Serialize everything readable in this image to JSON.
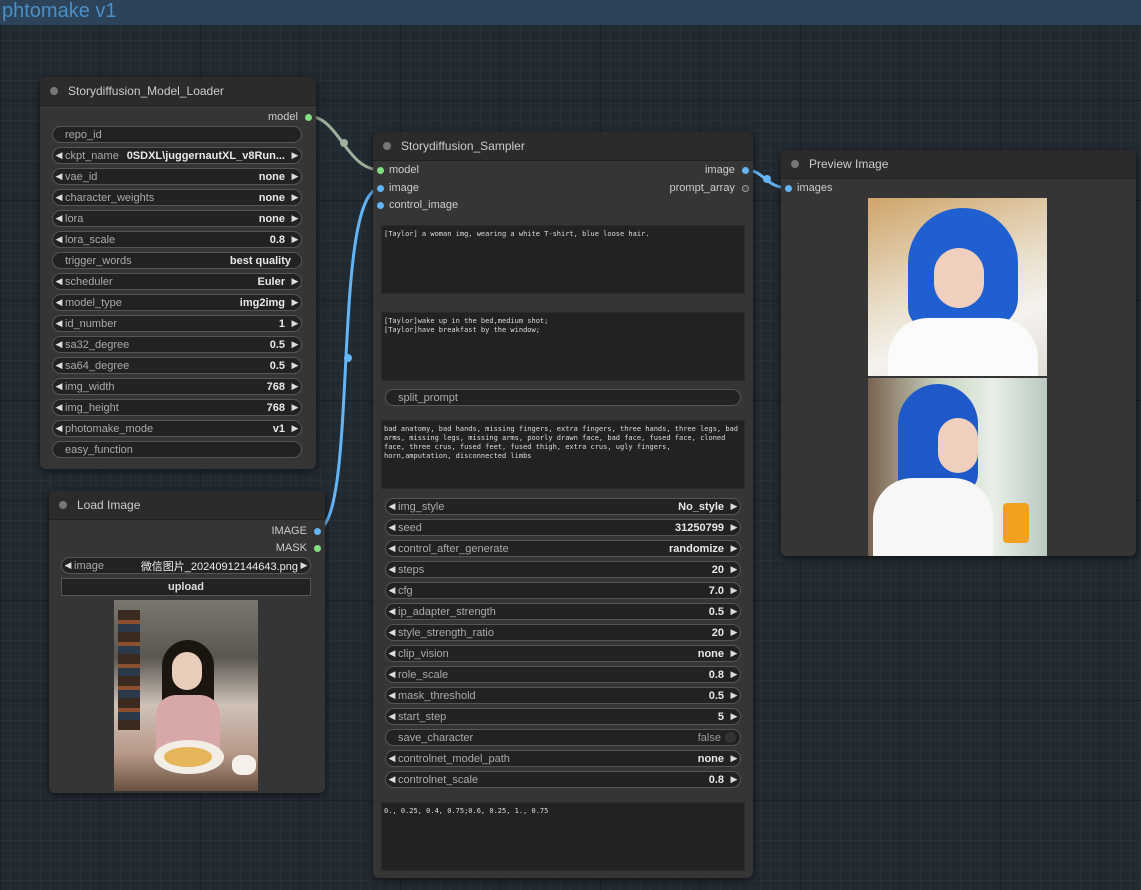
{
  "group": {
    "title": "phtomake v1"
  },
  "model_loader": {
    "title": "Storydiffusion_Model_Loader",
    "output_model": "model",
    "widgets": [
      {
        "label": "repo_id",
        "value": ""
      },
      {
        "label": "ckpt_name",
        "value": "0SDXL\\juggernautXL_v8Run..."
      },
      {
        "label": "vae_id",
        "value": "none"
      },
      {
        "label": "character_weights",
        "value": "none"
      },
      {
        "label": "lora",
        "value": "none"
      },
      {
        "label": "lora_scale",
        "value": "0.8"
      },
      {
        "label": "trigger_words",
        "value": "best quality"
      },
      {
        "label": "scheduler",
        "value": "Euler"
      },
      {
        "label": "model_type",
        "value": "img2img"
      },
      {
        "label": "id_number",
        "value": "1"
      },
      {
        "label": "sa32_degree",
        "value": "0.5"
      },
      {
        "label": "sa64_degree",
        "value": "0.5"
      },
      {
        "label": "img_width",
        "value": "768"
      },
      {
        "label": "img_height",
        "value": "768"
      },
      {
        "label": "photomake_mode",
        "value": "v1"
      },
      {
        "label": "easy_function",
        "value": ""
      }
    ]
  },
  "load_image": {
    "title": "Load Image",
    "output_image": "IMAGE",
    "output_mask": "MASK",
    "image_label": "image",
    "image_value": "微信图片_20240912144643.png",
    "upload_label": "upload"
  },
  "sampler": {
    "title": "Storydiffusion_Sampler",
    "inputs": [
      "model",
      "image",
      "control_image"
    ],
    "outputs": [
      "image",
      "prompt_array"
    ],
    "character_prompt": "[Taylor] a woman img, wearing a white T-shirt, blue loose hair.",
    "scene_prompts": "[Taylor]wake up in the bed,medium shot;\n[Taylor]have breakfast by the window;",
    "split_prompt_label": "split_prompt",
    "negative_prompt": "bad anatomy, bad hands, missing fingers, extra fingers, three hands, three legs, bad arms, missing legs, missing arms, poorly drawn face, bad face, fused face, cloned face, three crus, fused feet, fused thigh, extra crus, ugly fingers, horn,amputation, disconnected limbs",
    "widgets": [
      {
        "label": "img_style",
        "value": "No_style"
      },
      {
        "label": "seed",
        "value": "31250799"
      },
      {
        "label": "control_after_generate",
        "value": "randomize"
      },
      {
        "label": "steps",
        "value": "20"
      },
      {
        "label": "cfg",
        "value": "7.0"
      },
      {
        "label": "ip_adapter_strength",
        "value": "0.5"
      },
      {
        "label": "style_strength_ratio",
        "value": "20"
      },
      {
        "label": "clip_vision",
        "value": "none"
      },
      {
        "label": "role_scale",
        "value": "0.8"
      },
      {
        "label": "mask_threshold",
        "value": "0.5"
      },
      {
        "label": "start_step",
        "value": "5"
      }
    ],
    "save_character_label": "save_character",
    "save_character_value": "false",
    "widgets2": [
      {
        "label": "controlnet_model_path",
        "value": "none"
      },
      {
        "label": "controlnet_scale",
        "value": "0.8"
      }
    ],
    "layout_text": "0., 0.25, 0.4, 0.75;0.6, 0.25, 1., 0.75"
  },
  "preview": {
    "title": "Preview Image",
    "input_images": "images"
  },
  "colors": {
    "model_link": "#a8c9a8",
    "image_link": "#64b5f6"
  }
}
